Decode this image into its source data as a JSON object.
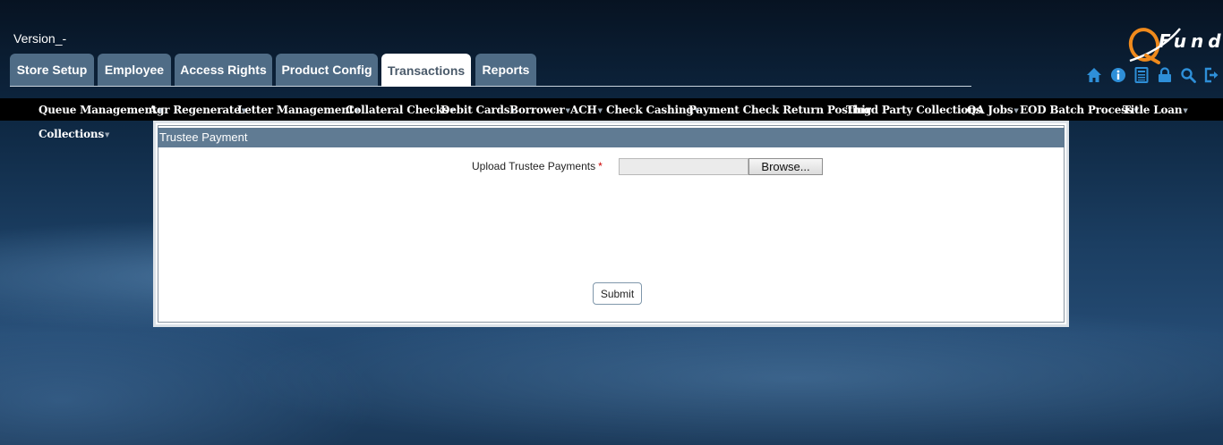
{
  "header": {
    "version": "Version_-",
    "logo_text": "Fund"
  },
  "tabs": [
    {
      "label": "Store Setup"
    },
    {
      "label": "Employee"
    },
    {
      "label": "Access Rights"
    },
    {
      "label": "Product Config"
    },
    {
      "label": "Transactions",
      "active": true
    },
    {
      "label": "Reports"
    }
  ],
  "toolbar_icons": [
    "home-icon",
    "info-icon",
    "calculator-icon",
    "lock-icon",
    "search-icon",
    "logout-icon"
  ],
  "menu": [
    {
      "label": "Queue Management"
    },
    {
      "label": "Agr Regenerate"
    },
    {
      "label": "Letter Management"
    },
    {
      "label": "Collateral Checks"
    },
    {
      "label": "Debit Cards"
    },
    {
      "label": "Borrower"
    },
    {
      "label": "ACH"
    },
    {
      "label": "Check Cashing"
    },
    {
      "label": "Payment Check Return Posting"
    },
    {
      "label": "Third Party Collections"
    },
    {
      "label": "QA Jobs"
    },
    {
      "label": "EOD Batch Process"
    },
    {
      "label": "Title Loan"
    },
    {
      "label": "Collections"
    }
  ],
  "form": {
    "title": "Trustee Payment",
    "upload_label": "Upload Trustee Payments",
    "required_mark": "*",
    "file_value": "",
    "browse_label": "Browse...",
    "submit_label": "Submit"
  },
  "colors": {
    "tab_bg": "#4f6c86",
    "panel_header": "#607b93",
    "menubar": "#000000",
    "accent_orange": "#f08a1c",
    "icon_blue": "#2e8fd8"
  }
}
